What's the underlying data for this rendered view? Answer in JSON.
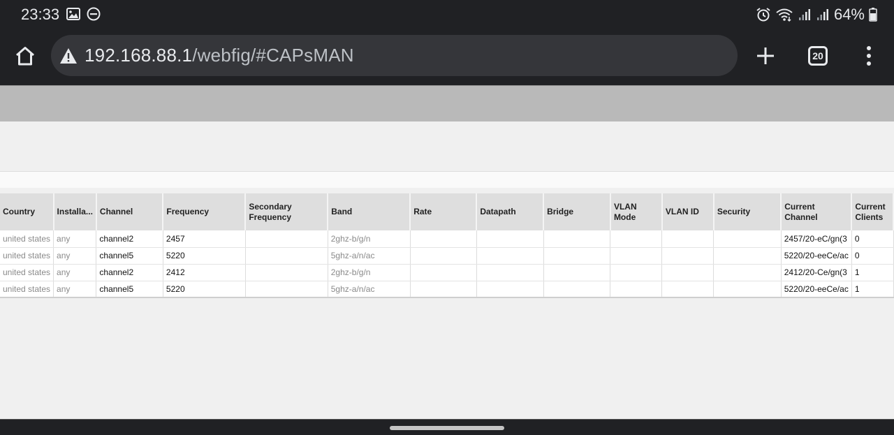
{
  "status_bar": {
    "time": "23:33",
    "battery": "64%",
    "left_icons": [
      "image-icon",
      "dnd-icon"
    ],
    "right_icons": [
      "alarm-icon",
      "wifi-icon",
      "signal-icon",
      "signal-icon",
      "battery-icon"
    ]
  },
  "browser": {
    "url_host": "192.168.88.1",
    "url_path": "/webfig/#CAPsMAN",
    "tab_count": "20",
    "colors": {
      "chrome": "#202124",
      "url_bar": "#35363a"
    }
  },
  "table": {
    "columns": [
      "Country",
      "Installa...",
      "Channel",
      "Frequency",
      "Secondary Frequency",
      "Band",
      "Rate",
      "Datapath",
      "Bridge",
      "VLAN Mode",
      "VLAN ID",
      "Security",
      "Current Channel",
      "Current Clients"
    ],
    "rows": [
      [
        "united states",
        "any",
        "channel2",
        "2457",
        "",
        "2ghz-b/g/n",
        "",
        "",
        "",
        "",
        "",
        "",
        "2457/20-eC/gn(3",
        "0"
      ],
      [
        "united states",
        "any",
        "channel5",
        "5220",
        "",
        "5ghz-a/n/ac",
        "",
        "",
        "",
        "",
        "",
        "",
        "5220/20-eeCe/ac",
        "0"
      ],
      [
        "united states",
        "any",
        "channel2",
        "2412",
        "",
        "2ghz-b/g/n",
        "",
        "",
        "",
        "",
        "",
        "",
        "2412/20-Ce/gn(3",
        "1"
      ],
      [
        "united states",
        "any",
        "channel5",
        "5220",
        "",
        "5ghz-a/n/ac",
        "",
        "",
        "",
        "",
        "",
        "",
        "5220/20-eeCe/ac",
        "1"
      ]
    ]
  }
}
